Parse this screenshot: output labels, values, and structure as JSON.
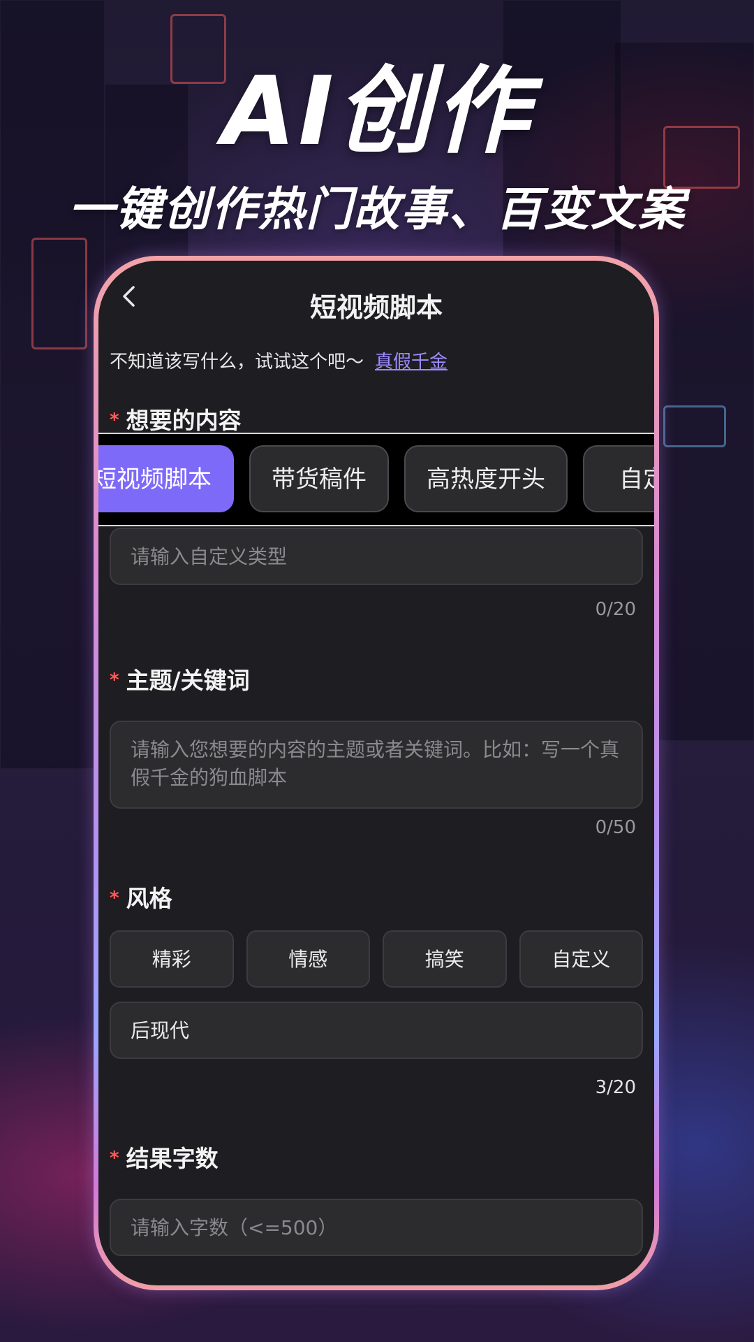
{
  "hero": {
    "title": "AI创作",
    "subtitle": "一键创作热门故事、百变文案"
  },
  "nav": {
    "back_icon": "chevron-left-icon",
    "title": "短视频脚本"
  },
  "hint": {
    "text": "不知道该写什么，试试这个吧～",
    "link": "真假千金"
  },
  "content_section": {
    "required_mark": "*",
    "label": "想要的内容",
    "chips": [
      "短视频脚本",
      "带货稿件",
      "高热度开头",
      "自定义"
    ],
    "selected_index": 0,
    "custom_type": {
      "placeholder": "请输入自定义类型",
      "value": "",
      "counter": "0/20"
    }
  },
  "topic_section": {
    "required_mark": "*",
    "label": "主题/关键词",
    "placeholder": "请输入您想要的内容的主题或者关键词。比如：写一个真假千金的狗血脚本",
    "counter": "0/50"
  },
  "style_section": {
    "required_mark": "*",
    "label": "风格",
    "options": [
      "精彩",
      "情感",
      "搞笑",
      "自定义"
    ],
    "custom_value": "后现代",
    "counter": "3/20"
  },
  "length_section": {
    "required_mark": "*",
    "label": "结果字数",
    "placeholder": "请输入字数（<=500）"
  },
  "colors": {
    "accent": "#7e6af8",
    "link": "#9f8cff",
    "required": "#ff5a5a",
    "screen_bg": "#1e1d21"
  }
}
